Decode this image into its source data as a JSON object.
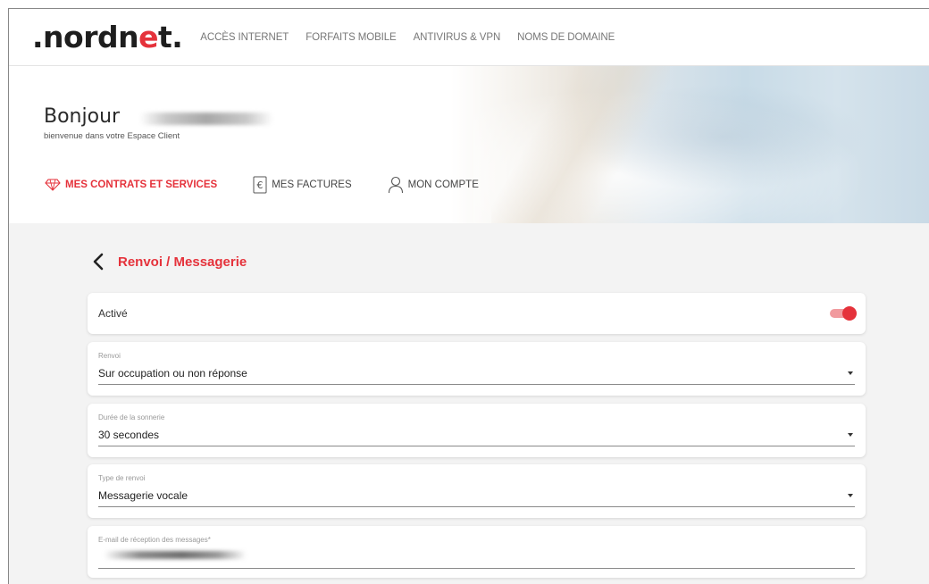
{
  "header": {
    "logo_text": ".nordnet.",
    "nav": [
      {
        "label": "ACCÈS INTERNET"
      },
      {
        "label": "FORFAITS MOBILE"
      },
      {
        "label": "ANTIVIRUS & VPN"
      },
      {
        "label": "NOMS DE DOMAINE"
      }
    ]
  },
  "hero": {
    "greeting": "Bonjour",
    "subtitle": "bienvenue dans votre Espace Client",
    "tabs": [
      {
        "label": "MES CONTRATS ET SERVICES",
        "icon": "gem-icon",
        "active": true
      },
      {
        "label": "MES FACTURES",
        "icon": "euro-icon",
        "active": false
      },
      {
        "label": "MON COMPTE",
        "icon": "user-icon",
        "active": false
      }
    ]
  },
  "page": {
    "title": "Renvoi / Messagerie",
    "toggle": {
      "label": "Activé",
      "on": true
    },
    "fields": [
      {
        "label": "Renvoi",
        "value": "Sur occupation ou non réponse"
      },
      {
        "label": "Durée de la sonnerie",
        "value": "30 secondes"
      },
      {
        "label": "Type de renvoi",
        "value": "Messagerie vocale"
      },
      {
        "label": "E-mail de réception des messages*",
        "value": ""
      }
    ]
  },
  "colors": {
    "accent": "#e5323b",
    "background": "#f3f3f3"
  }
}
